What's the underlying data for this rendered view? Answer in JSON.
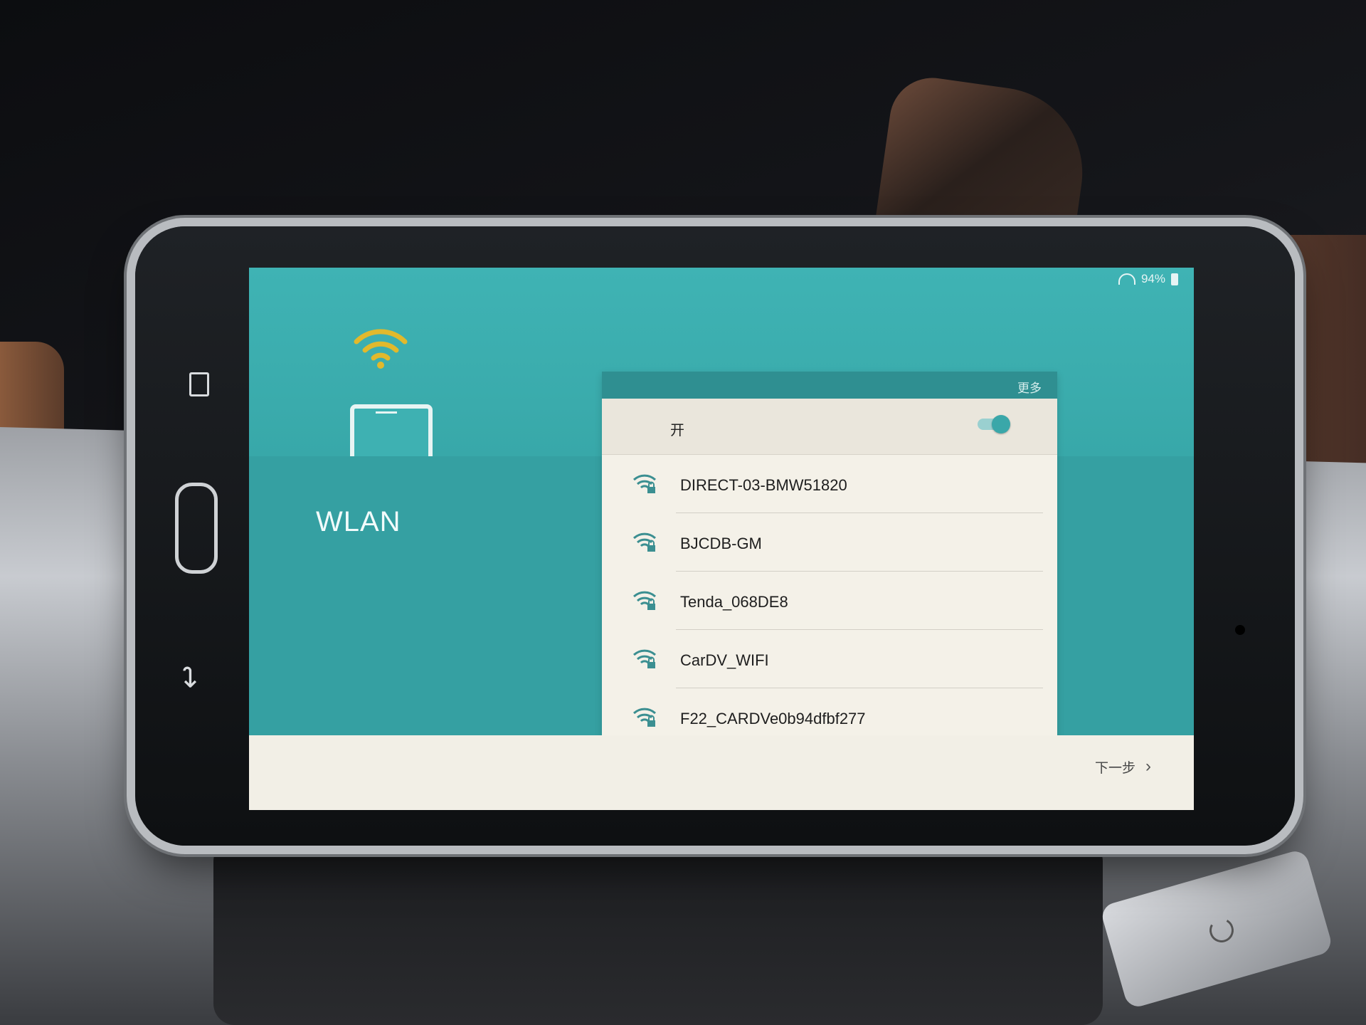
{
  "status": {
    "battery": "94%"
  },
  "screen": {
    "title": "WLAN",
    "more": "更多",
    "toggle_label": "开",
    "next": "下一步"
  },
  "networks": [
    {
      "ssid": "DIRECT-03-BMW51820"
    },
    {
      "ssid": "BJCDB-GM"
    },
    {
      "ssid": "Tenda_068DE8"
    },
    {
      "ssid": "CarDV_WIFI"
    },
    {
      "ssid": "F22_CARDVe0b94dfbf277"
    }
  ],
  "colors": {
    "teal": "#38a8a9",
    "panel": "#f4f1e8",
    "wifi_yellow": "#e1b92c"
  },
  "icons": {
    "wifi_large": "wifi-icon",
    "wifi_locked": "wifi-lock-icon",
    "next": "chevron-right-icon"
  }
}
